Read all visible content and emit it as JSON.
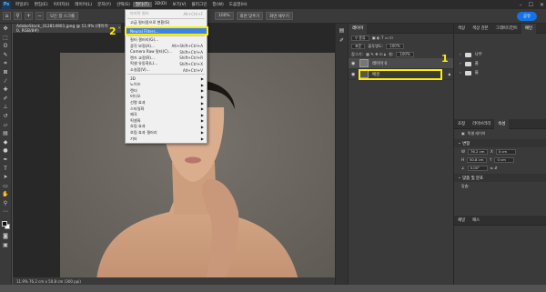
{
  "menubar": {
    "logo": "Ps",
    "items": [
      "파일(F)",
      "편집(E)",
      "이미지(I)",
      "레이어(L)",
      "문자(Y)",
      "선택(S)",
      "필터(T)",
      "3D(D)",
      "보기(V)",
      "플러그인",
      "창(W)",
      "도움말(H)"
    ],
    "active_index": 6
  },
  "optionsbar": {
    "buttons": [
      "모든 창 스크롤",
      "100%",
      "화면 맞추기",
      "화면 채우기"
    ],
    "share_label": "공유"
  },
  "document": {
    "tab_title": "AdobeStock_312814901.jpeg @ 11.9% (레이어 0, RGB/8#)",
    "status": "11.9%     76.2 cm x 50.8 cm (300 ppi)"
  },
  "filter_menu": {
    "items": [
      {
        "label": "마지막 필터",
        "shortcut": "Alt+Ctrl+F",
        "disabled": true
      },
      {
        "sep": true
      },
      {
        "label": "고급 필터용으로 변환(S)",
        "shortcut": ""
      },
      {
        "sep": true
      },
      {
        "label": "Neural Filters...",
        "shortcut": "",
        "selected": true
      },
      {
        "sep": true
      },
      {
        "label": "필터 갤러리(G)...",
        "shortcut": ""
      },
      {
        "label": "광각 보정(A)...",
        "shortcut": "Alt+Shift+Ctrl+A"
      },
      {
        "label": "Camera Raw 필터(C)...",
        "shortcut": "Shift+Ctrl+A"
      },
      {
        "label": "렌즈 교정(R)...",
        "shortcut": "Shift+Ctrl+R"
      },
      {
        "label": "픽셀 유동화(L)...",
        "shortcut": "Shift+Ctrl+X"
      },
      {
        "label": "소실점(V)...",
        "shortcut": "Alt+Ctrl+V"
      },
      {
        "sep": true
      },
      {
        "label": "3D",
        "sub": true
      },
      {
        "label": "노이즈",
        "sub": true
      },
      {
        "label": "렌더",
        "sub": true
      },
      {
        "label": "비디오",
        "sub": true
      },
      {
        "label": "선명 효과",
        "sub": true
      },
      {
        "label": "스타일화",
        "sub": true
      },
      {
        "label": "왜곡",
        "sub": true
      },
      {
        "label": "픽셀화",
        "sub": true
      },
      {
        "label": "흐림 효과",
        "sub": true
      },
      {
        "label": "흐림 효과 갤러리",
        "sub": true
      },
      {
        "label": "기타",
        "sub": true
      }
    ]
  },
  "callouts": {
    "one": "1",
    "two": "2"
  },
  "layers_panel": {
    "tabs": [
      "레이어"
    ],
    "kind_label": "종류",
    "blend_mode": "표준",
    "opacity_label": "불투명도:",
    "opacity_value": "100%",
    "lock_label": "잠그기:",
    "fill_label": "칠:",
    "fill_value": "100%",
    "layers": [
      {
        "name": "레이어 0",
        "selected": true
      },
      {
        "name": "배경",
        "selected": false
      }
    ]
  },
  "right_panel": {
    "tabs": [
      "색상",
      "색상 견본",
      "그레이디언트",
      "패턴"
    ],
    "folders": [
      "나무",
      "풀",
      "물"
    ],
    "props_tabs": [
      "조정",
      "라이브러리",
      "속성"
    ],
    "props_subtitle": "픽셀 레이어",
    "transform_title": "변형",
    "w_label": "W",
    "w_value": "76.2 cm",
    "h_label": "H",
    "h_value": "50.8 cm",
    "x_label": "X",
    "x_value": "0 cm",
    "y_label": "Y",
    "y_value": "0 cm",
    "angle_value": "0.00°",
    "align_title": "맞춤 및 분포",
    "align_sub": "맞춤:",
    "bottom_tabs": [
      "채널",
      "패스"
    ]
  }
}
